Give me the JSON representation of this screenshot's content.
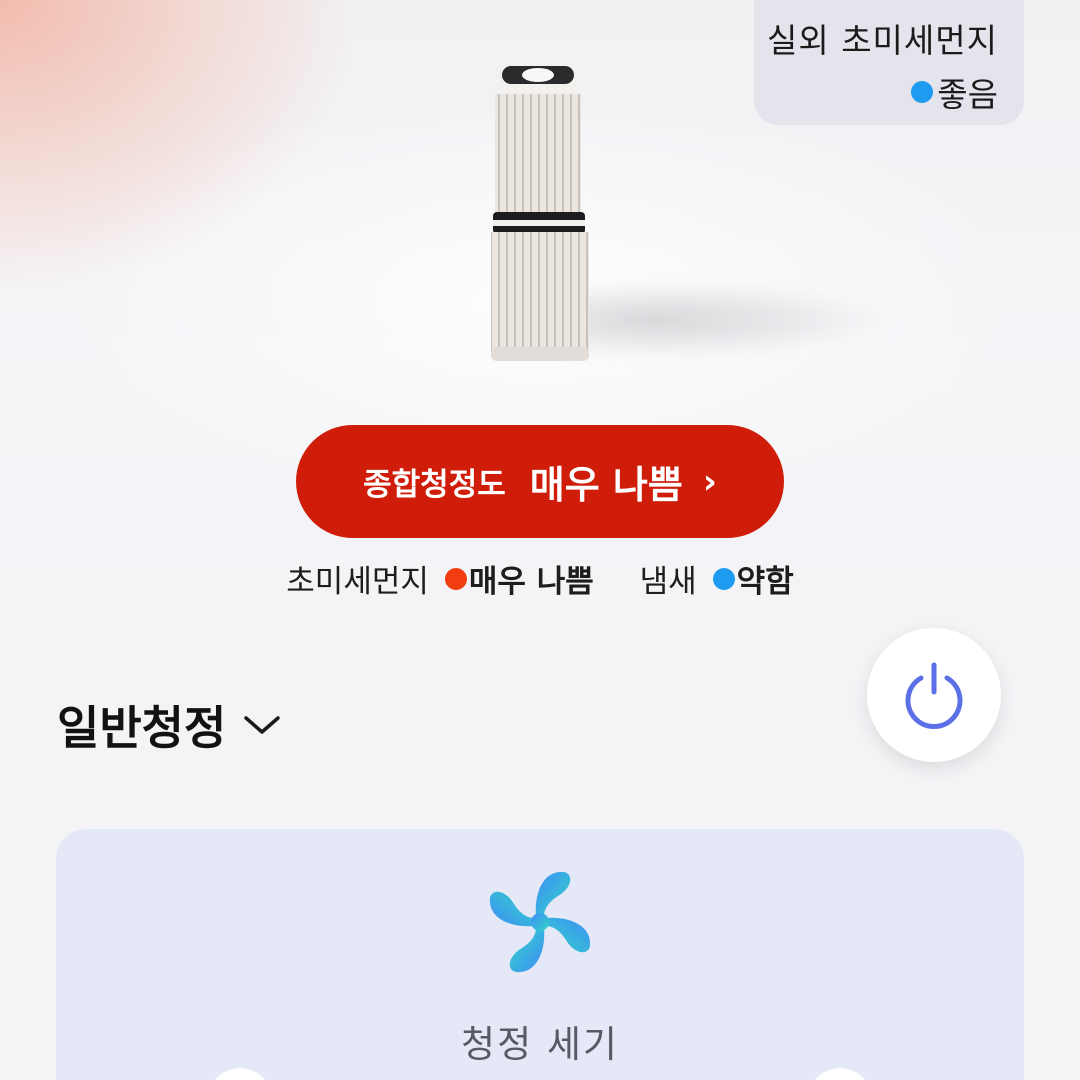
{
  "outdoor": {
    "title": "실외 초미세먼지",
    "status": "좋음",
    "status_color": "#1e9bf0"
  },
  "air_quality": {
    "label": "종합청정도",
    "value": "매우 나쁨",
    "chevron": "›",
    "color": "#cf1d0a"
  },
  "metrics": [
    {
      "label": "초미세먼지",
      "value": "매우 나쁨",
      "color": "#f23d12"
    },
    {
      "label": "냄새",
      "value": "약함",
      "color": "#1e9bf0"
    }
  ],
  "mode": {
    "label": "일반청정",
    "icon": "chevron-down-icon"
  },
  "power": {
    "icon": "power-icon",
    "color": "#5b6fe6"
  },
  "fan_panel": {
    "icon": "fan-icon",
    "label": "청정 세기"
  }
}
